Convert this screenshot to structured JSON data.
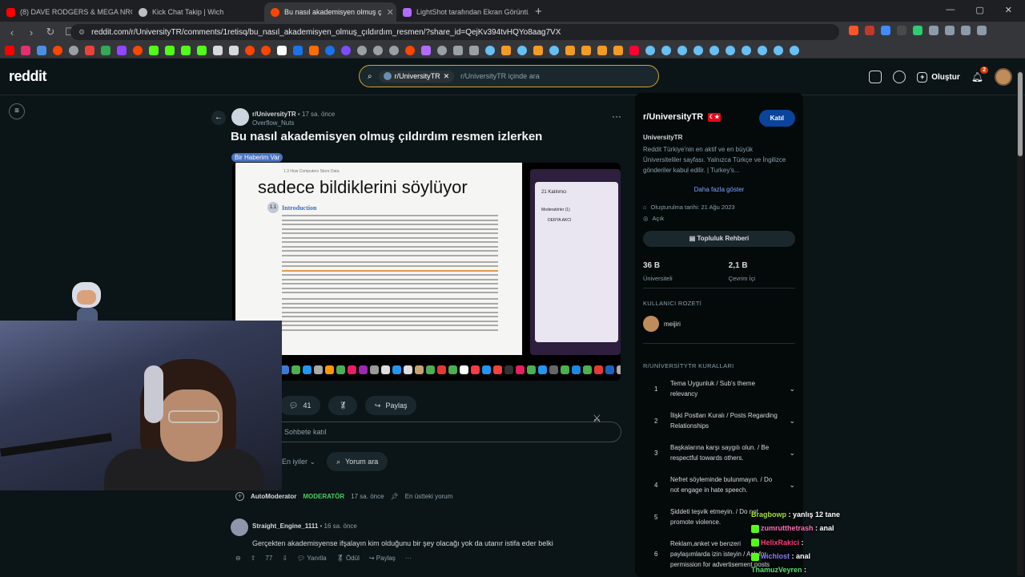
{
  "browser": {
    "tabs": [
      {
        "title": "(8) DAVE RODGERS & MEGA NRG M",
        "color": "#ff0000"
      },
      {
        "title": "Kick Chat Takip | Wich",
        "color": "#bdbdbd"
      },
      {
        "title": "Bu nasıl akademisyen olmuş ç",
        "color": "#ff4500"
      },
      {
        "title": "LightShot tarafından Ekran Görüntüs",
        "color": "#b36bff"
      }
    ],
    "url": "reddit.com/r/UniversityTR/comments/1retisq/bu_nasıl_akademisyen_olmuş_çıldırdım_resmen/?share_id=QejKv394tvHQYo8aag7VX"
  },
  "header": {
    "logo": "reddit",
    "search_chip": "r/UniversityTR",
    "search_placeholder": "r/UniversityTR içinde ara",
    "create_label": "Oluştur",
    "notif_count": "2"
  },
  "post": {
    "subreddit": "r/UniversityTR",
    "time": "17 sa. önce",
    "author": "Overflow_Nuts",
    "title": "Bu nasıl akademisyen olmuş çıldırdım resmen izlerken",
    "flair": "Bir Haberim Var",
    "image_caption": "sadece bildiklerini söylüyor",
    "doc_header": "1.3   How Computers Store Data",
    "doc_section_num": "1.1",
    "doc_section": "Introduction",
    "side_panel_title": "21 Katılımcı",
    "side_panel_sub": "Moderatörler (1)",
    "side_panel_name": "DERYA AKCI",
    "comment_count": "41",
    "share_label": "Paylaş",
    "comment_placeholder": "Sohbete katıl",
    "sort_label": "En iyiler",
    "search_comments": "Yorum ara"
  },
  "comments": [
    {
      "author": "AutoModerator",
      "role": "MODERATÖR",
      "time": "17 sa. önce",
      "pinned": "En üstteki yorum"
    },
    {
      "author": "Straight_Engine_1111",
      "time": "16 sa. önce",
      "body": "Gerçekten akademisyense ifşalayın kim olduğunu bir şey olacağı yok da utanır istifa eder belki",
      "votes": "77",
      "reply": "Yanıtla",
      "award": "Ödül",
      "share": "Paylaş"
    }
  ],
  "sidebar": {
    "title": "r/UniversityTR",
    "join_label": "Katıl",
    "name": "UniversityTR",
    "description": "Reddit Türkiye'nin en aktif ve en büyük Üniversiteliler sayfası. Yalnızca Türkçe ve İngilizce gönderiler kabul edilir. | Turkey's...",
    "show_more": "Daha fazla göster",
    "created": "Oluşturulma tarihi: 21 Ağu 2023",
    "visibility": "Açık",
    "guide_label": "Topluluk Rehberi",
    "members": "36 B",
    "members_label": "Üniversiteli",
    "online": "2,1 B",
    "online_label": "Çevrim İçi",
    "badge_section": "KULLANICI ROZETİ",
    "badge_user": "meijiri",
    "rules_section": "R/UNİVERSİTYTR KURALLARI",
    "rules": [
      {
        "n": "1",
        "text": "Tema Uygunluk / Sub's theme relevancy"
      },
      {
        "n": "2",
        "text": "İlişki Postları Kuralı / Posts Regarding Relationships"
      },
      {
        "n": "3",
        "text": "Başkalarına karşı saygılı olun. / Be respectful towards others."
      },
      {
        "n": "4",
        "text": "Nefret söyleminde bulunmayın. / Do not engage in hate speech."
      },
      {
        "n": "5",
        "text": "Şiddeti teşvik etmeyin. / Do not promote violence."
      },
      {
        "n": "6",
        "text": "Reklam,anket ve benzeri paylaşımlarda izin isteyin / Ask for permission for advertisement posts"
      }
    ]
  },
  "chat": [
    {
      "user": "Bragbowp",
      "msg": "yanlış 12 tane"
    },
    {
      "user": "zumrutthetrash",
      "msg": "anal"
    },
    {
      "user": "HelixRakici",
      "msg": ""
    },
    {
      "user": "wichlost",
      "msg": "anal"
    },
    {
      "user": "ThamuzVeyren",
      "msg": ""
    }
  ]
}
